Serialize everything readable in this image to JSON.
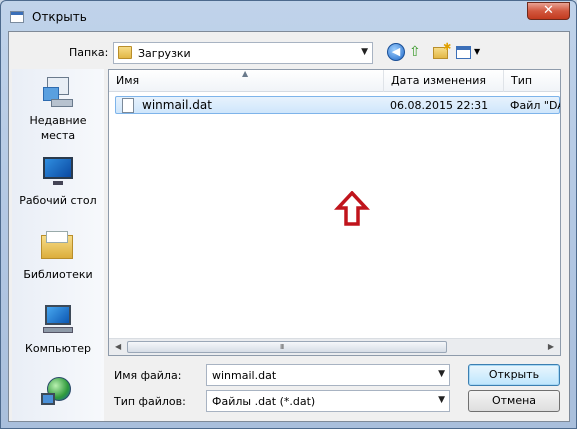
{
  "window": {
    "title": "Открыть",
    "close_label": "✕"
  },
  "toolbar": {
    "folder_label": "Папка:",
    "folder_value": "Загрузки",
    "back_icon": "back-arrow-icon",
    "up_icon": "up-folder-icon",
    "new_folder_icon": "new-folder-icon",
    "view_icon": "view-menu-icon"
  },
  "places": [
    {
      "label_line1": "Недавние",
      "label_line2": "места",
      "icon": "recent-places-icon"
    },
    {
      "label_line1": "Рабочий стол",
      "label_line2": "",
      "icon": "desktop-icon"
    },
    {
      "label_line1": "Библиотеки",
      "label_line2": "",
      "icon": "libraries-icon"
    },
    {
      "label_line1": "Компьютер",
      "label_line2": "",
      "icon": "computer-icon"
    },
    {
      "label_line1": "",
      "label_line2": "",
      "icon": "network-icon"
    }
  ],
  "list": {
    "columns": [
      "Имя",
      "Дата изменения",
      "Тип"
    ],
    "rows": [
      {
        "name": "winmail.dat",
        "date": "06.08.2015 22:31",
        "type": "Файл \"DA"
      }
    ],
    "scroll_grip": "III"
  },
  "bottom": {
    "filename_label": "Имя файла:",
    "filename_value": "winmail.dat",
    "filetype_label": "Тип файлов:",
    "filetype_value": "Файлы .dat (*.dat)",
    "open_button": "Открыть",
    "cancel_button": "Отмена"
  },
  "colors": {
    "accent_arrow": "#c0141c",
    "selection": "#cfe6fb"
  }
}
